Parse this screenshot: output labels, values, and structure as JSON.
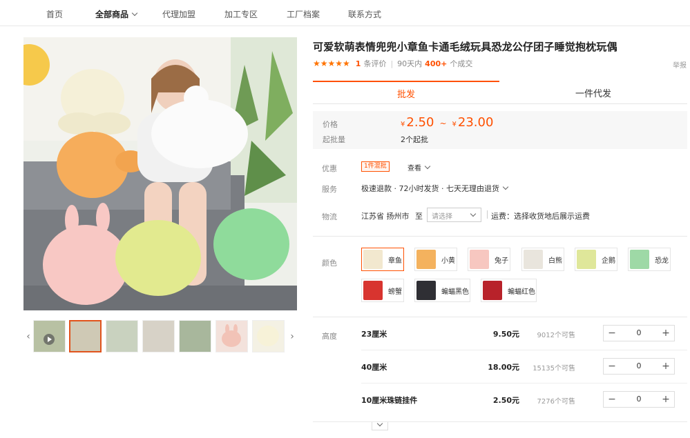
{
  "nav": {
    "items": [
      {
        "label": "首页",
        "active": false
      },
      {
        "label": "全部商品",
        "active": true
      },
      {
        "label": "代理加盟",
        "active": false
      },
      {
        "label": "加工专区",
        "active": false
      },
      {
        "label": "工厂档案",
        "active": false
      },
      {
        "label": "联系方式",
        "active": false
      }
    ]
  },
  "product": {
    "title": "可爱软萌表情兜兜小章鱼卡通毛绒玩具恐龙公仔团子睡觉抱枕玩偶",
    "stars": "★★★★★",
    "review_count": "1",
    "review_label": "条评价",
    "period_label": "90天内",
    "deals": "400+",
    "deals_label": "个成交",
    "report": "举报"
  },
  "tabs": {
    "wholesale": "批发",
    "dropship": "一件代发"
  },
  "pricing": {
    "price_label": "价格",
    "currency": "¥",
    "min_price": "2.50",
    "range_sep": "~",
    "max_price": "23.00",
    "moq_label": "起批量",
    "moq_value": "2个起批"
  },
  "offers": {
    "label": "优惠",
    "coupon": "1件混批",
    "more": "查看",
    "service_label": "服务",
    "service_text": "极速退款 · 72小时发货 · 七天无理由退货",
    "logistics_label": "物流",
    "ship_from": "江苏省 扬州市",
    "ship_to": "至",
    "ship_placeholder": "请选择",
    "freight": "运费：选择收货地后展示运费"
  },
  "colors": {
    "label": "颜色",
    "options": [
      {
        "label": "章鱼",
        "swatch": "#f2e8cf",
        "active": true
      },
      {
        "label": "小黄",
        "swatch": "#f4b25e",
        "active": false
      },
      {
        "label": "兔子",
        "swatch": "#f7c7c0",
        "active": false
      },
      {
        "label": "白熊",
        "swatch": "#e9e5dd",
        "active": false
      },
      {
        "label": "企鹅",
        "swatch": "#dfe79a",
        "active": false
      },
      {
        "label": "恐龙",
        "swatch": "#9ed9a6",
        "active": false
      },
      {
        "label": "螃蟹",
        "swatch": "#d8342f",
        "active": false
      },
      {
        "label": "蝙蝠黑色",
        "swatch": "#2f2f34",
        "active": false
      },
      {
        "label": "蝙蝠红色",
        "swatch": "#b8222a",
        "active": false
      }
    ]
  },
  "sizes": {
    "label": "高度",
    "rows": [
      {
        "name": "23厘米",
        "price": "9.50元",
        "stock": "9012个可售",
        "qty": "0"
      },
      {
        "name": "40厘米",
        "price": "18.00元",
        "stock": "15135个可售",
        "qty": "0"
      },
      {
        "name": "10厘米珠链挂件",
        "price": "2.50元",
        "stock": "7276个可售",
        "qty": "0"
      }
    ],
    "minus": "−",
    "plus": "+"
  },
  "gallery": {
    "prev": "‹",
    "next": "›"
  }
}
